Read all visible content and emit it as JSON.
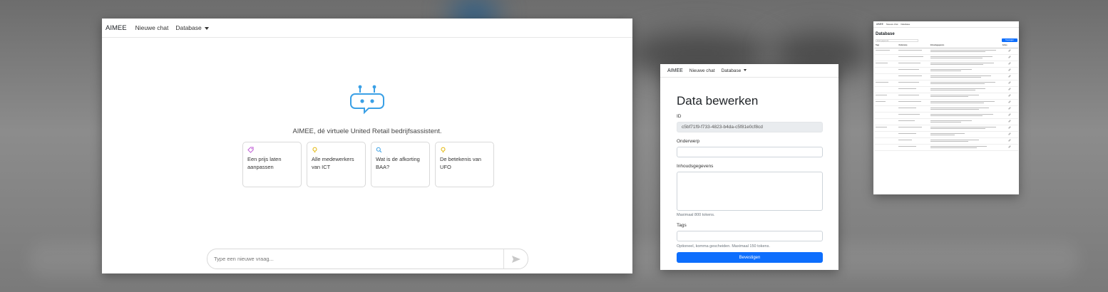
{
  "chat_window": {
    "brand": "AIMEE",
    "nav": {
      "new_chat": "Nieuwe chat",
      "database": "Database"
    },
    "assistant_line": "AIMEE, dé virtuele United Retail bedrijfsassistent.",
    "suggestions": [
      {
        "icon": "tag-icon",
        "icon_color": "#c05ed6",
        "label": "Een prijs laten aanpassen"
      },
      {
        "icon": "lightbulb-icon",
        "icon_color": "#e2b400",
        "label": "Alle medewerkers van ICT"
      },
      {
        "icon": "search-icon",
        "icon_color": "#3aa0e6",
        "label": "Wat is de afkorting BAA?"
      },
      {
        "icon": "lightbulb-icon",
        "icon_color": "#e2b400",
        "label": "De betekenis van UFO"
      }
    ],
    "input": {
      "placeholder": "Type een nieuwe vraag..."
    },
    "logo_color": "#3aa0e6"
  },
  "edit_window": {
    "brand": "AIMEE",
    "nav": {
      "new_chat": "Nieuwe chat",
      "database": "Database"
    },
    "title": "Data bewerken",
    "id_label": "ID",
    "id_value": "c5bf71f9-f733-4823-b4da-c5f81e0cf8cd",
    "subject_label": "Onderwerp",
    "content_label": "Inhoudsgegevens",
    "content_help": "Maximaal 800 tokens.",
    "tags_label": "Tags",
    "tags_help": "Optioneel, komma gescheiden. Maximaal 150 tokens.",
    "submit_label": "Bevestigen",
    "accent": "#0d6efd"
  },
  "db_window": {
    "brand": "AIMEE",
    "nav": {
      "new_chat": "Nieuwe chat",
      "database": "Database"
    },
    "title": "Database",
    "search_placeholder": "Zoek gegevens",
    "add_label": "Toevoegen",
    "columns": [
      "Tags",
      "Onderwerp",
      "Inhoudsgegevens",
      "Acties"
    ]
  }
}
